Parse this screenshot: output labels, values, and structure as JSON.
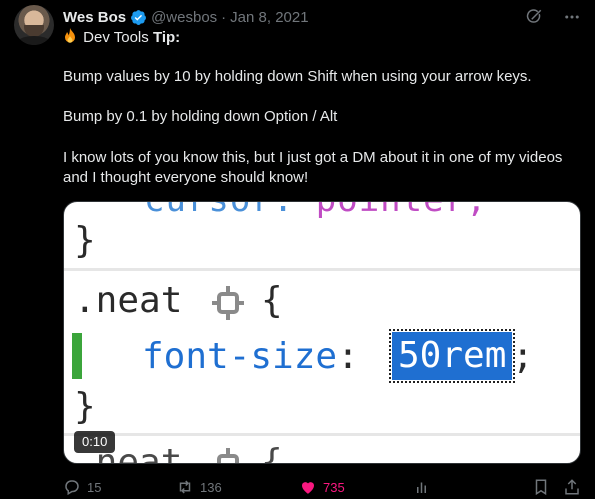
{
  "author": {
    "name": "Wes Bos",
    "handle": "@wesbos",
    "separator": "·",
    "date": "Jan 8, 2021"
  },
  "icons": {
    "avatar": "avatar-photo",
    "verified": "verified-badge-icon",
    "grok": "grok-icon",
    "more": "more-icon",
    "fire": "fire-emoji",
    "reply": "reply-icon",
    "retweet": "retweet-icon",
    "like": "heart-icon",
    "views": "views-icon",
    "bookmark": "bookmark-icon",
    "share": "share-icon"
  },
  "tweet": {
    "tip_prefix": "Dev Tools ",
    "tip_bold": "Tip:",
    "line2": "Bump values by 10 by holding down Shift when using your arrow keys.",
    "line3": "Bump by 0.1 by holding down Option / Alt",
    "line4": "I know lots of you know this, but I just got a DM about it in one of my videos",
    "line5": "and I thought everyone should know!"
  },
  "media": {
    "code_top_partial_a": "cursor: ",
    "code_top_partial_b": "pointer;",
    "brace_close": "}",
    "selector": ".neat",
    "brace_open": "{",
    "property": "font-size",
    "colon": ":",
    "value": "50rem",
    "semicolon": ";",
    "bottom_partial": ".neat",
    "bottom_brace": "{",
    "timestamp": "0:10"
  },
  "metrics": {
    "replies": "15",
    "retweets": "136",
    "likes": "735"
  },
  "colors": {
    "background": "#000000",
    "verified": "#1d9bf0",
    "like": "#f91880",
    "muted": "#71767b",
    "code_property": "#1f6fd1",
    "code_added": "#3ba53b"
  }
}
